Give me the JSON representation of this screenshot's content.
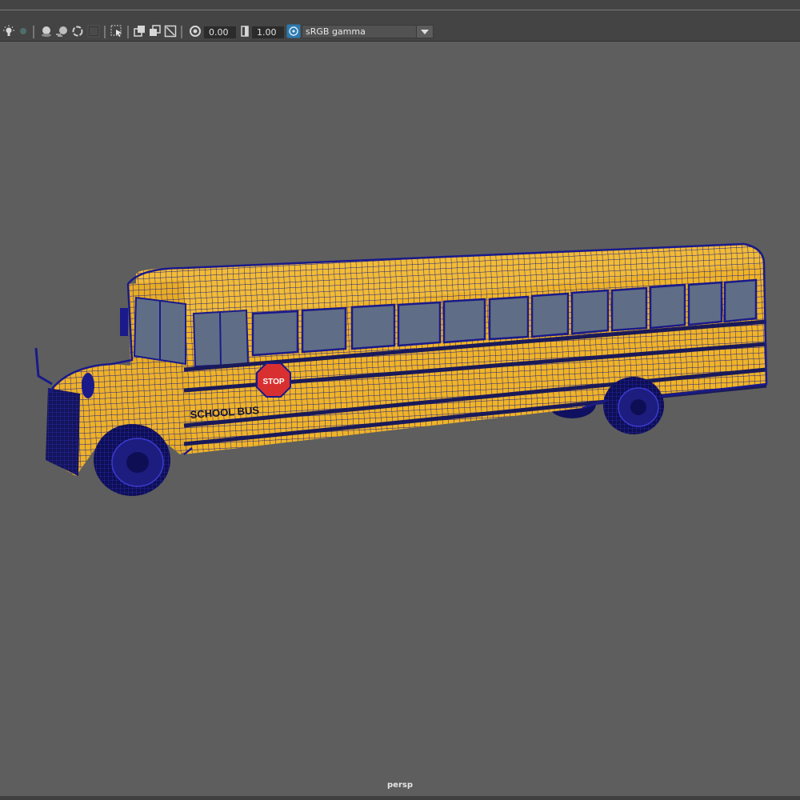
{
  "toolbar": {
    "icons": [
      "light-bulb-icon",
      "shadow-toggle-icon",
      "ambient-occlusion-icon",
      "motion-blur-icon",
      "antialias-icon",
      "textured-icon",
      "isolate-select-icon",
      "xray-icon",
      "xray-joints-icon",
      "xray-active-icon",
      "exposure-icon",
      "gamma-icon",
      "color-management-icon"
    ],
    "exposure_value": "0.00",
    "gamma_value": "1.00",
    "color_space": "sRGB gamma"
  },
  "bus": {
    "side_text": "SCHOOL BUS",
    "stop_sign_text": "STOP",
    "colors": {
      "body": "#f0b428",
      "wire": "#1a1a8a",
      "glass": "#5f6e86",
      "stripe": "#2a2a2a"
    }
  },
  "viewport": {
    "camera_name": "persp",
    "background": "#5e5e5e"
  }
}
